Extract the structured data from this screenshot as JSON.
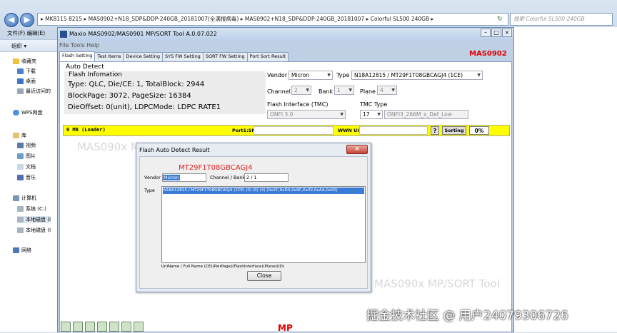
{
  "explorer": {
    "address": "▸ MK8115 8215  ▸  MAS0902+N18_SDP&DDP-240GB_20181007(全满报病毒)  ▸  MAS0902+N18_SDP&DDP-240GB_20181007  ▸  Colorful SL500 240GB  ▸",
    "search_placeholder": "搜索 Colorful SL500 240GB",
    "menu": "文件(F)  编辑(E)",
    "organize": "组织 ▾",
    "nav": {
      "favorites": "收藏夹",
      "downloads": "下载",
      "desktop": "桌面",
      "recent": "最近访问的",
      "wps": "WPS网盘",
      "libraries": "库",
      "videos": "视频",
      "pictures": "图片",
      "documents": "文档",
      "music": "音乐",
      "computer": "计算机",
      "system_c": "系统 (C:)",
      "local_disk_1": "本地磁盘 (I",
      "local_disk_2": "本地磁盘 (I",
      "network": "网络"
    }
  },
  "app": {
    "title": "Maxio MAS0902/MAS0901 MP/SORT Tool A.0.07.022",
    "menu": "File   Tools   Help",
    "brand": "MAS0902",
    "tabs": [
      "Flash Setting",
      "Test Items",
      "Device Setting",
      "SYS FW Setting",
      "SORT FW Setting",
      "Port Sort Result"
    ],
    "auto_detect": {
      "title": "Auto Detect",
      "flash_info_title": "Flash Infomation",
      "line1": "Type: QLC, Die/CE: 1, TotalBlock: 2944",
      "line2": "BlockPage: 3072, PageSize: 16384",
      "line3": "DieOffset: 0(unit), LDPCMode: LDPC RATE1"
    },
    "fields": {
      "vendor_label": "Vendor",
      "vendor_value": "Micron",
      "type_label": "Type",
      "type_value": "N18A12815  /  MT29F1T08GBCAGJ4 (1CE)",
      "channel_label": "Channel",
      "channel_value": "2",
      "bank_label": "Bank",
      "bank_value": "1",
      "plane_label": "Plane",
      "plane_value": "4",
      "flash_if_label": "Flash Interface (TMC)",
      "flash_if_value": "ONFI 3.0",
      "tmc_label": "TMC Type",
      "tmc_num": "17",
      "tmc_value": "ONFI3_266M_x_Def_Low"
    },
    "port_bar": {
      "status": "0 MB (Loader)",
      "port_sn_label": "Port1:SN",
      "wwn_label": "WWN UID",
      "help": "?",
      "sorting": "Sorting",
      "percent": "0%"
    },
    "watermarks": [
      "MAS090x MP/SORT Tool",
      "MAS090x MP/SORT Tool"
    ],
    "mp_label": "MP"
  },
  "dialog": {
    "title": "Flash Auto Detect Result",
    "part": "MT29F1T08GBCAGJ4",
    "vendor_label": "Vendor",
    "vendor_value": "Micron",
    "cb_label": "Channel / Bank",
    "cb_value": "2 / 1",
    "type_label": "Type",
    "list_row": "N18A12815  /  MT29F1T08GBCAGJ4 (1CE) (0) (0) (4) (0x2C,0xD4,0x8C,0x32,0xAA,0x00)",
    "footer": "UniName / Full Name (CE)(PairPage)(FlashInterface)(Plane)(ID)",
    "close_label": "Close"
  },
  "overlay": "掘金技术社区 @ 用户24079306726"
}
